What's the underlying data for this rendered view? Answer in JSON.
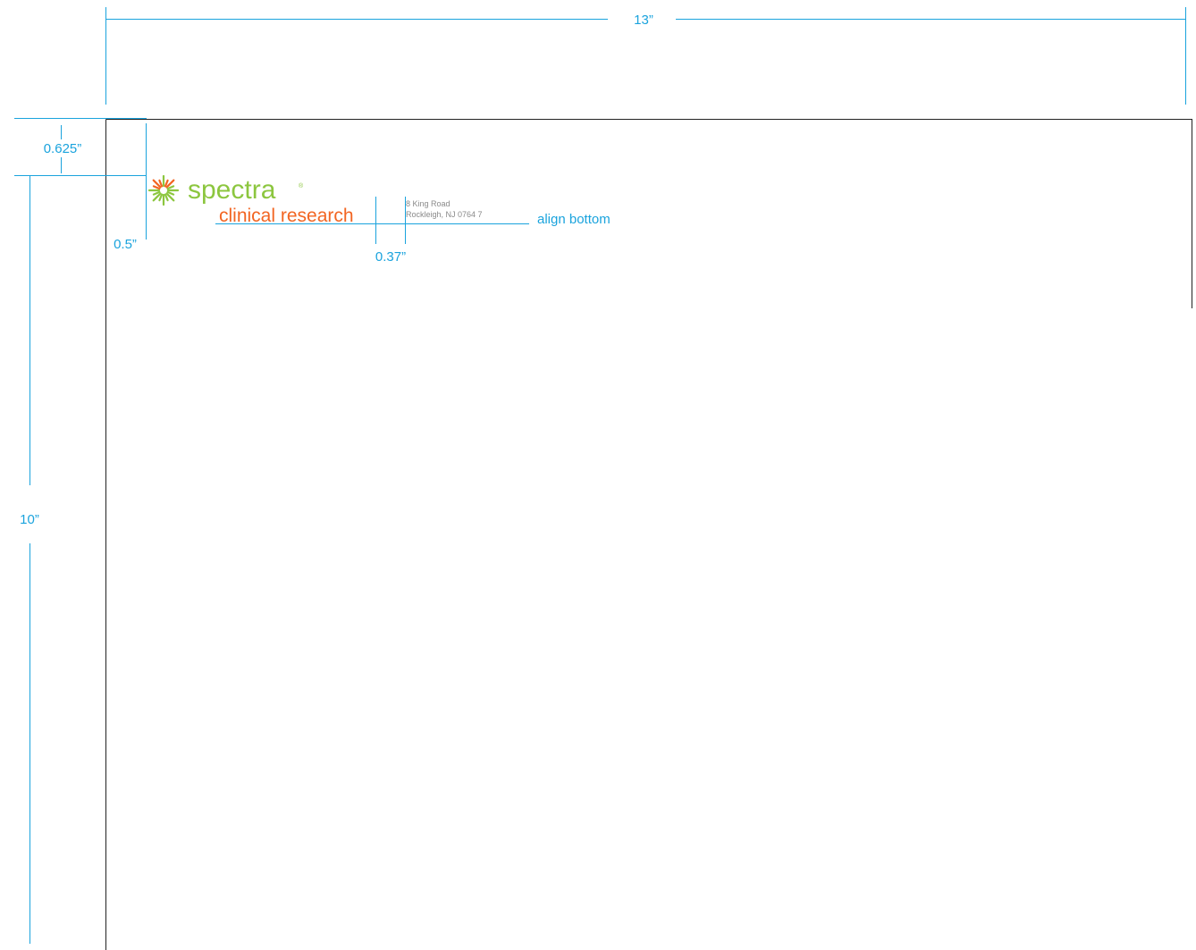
{
  "dimensions": {
    "width_label": "13”",
    "height_label": "10”",
    "top_margin_label": "0.625”",
    "left_margin_label": "0.5”",
    "gap_label": "0.37”",
    "align_note": "align bottom"
  },
  "logo": {
    "wordmark": "spectra",
    "registered": "®",
    "tagline": "clinical research",
    "icon": "starburst-icon"
  },
  "address": {
    "line1": "8 King Road",
    "line2": "Rockleigh,  NJ 0764  7"
  },
  "colors": {
    "guide": "#1aa3dd",
    "brand_green": "#8cc63f",
    "brand_orange": "#f26522",
    "address_gray": "#8a8a8a",
    "page_border": "#222222"
  }
}
